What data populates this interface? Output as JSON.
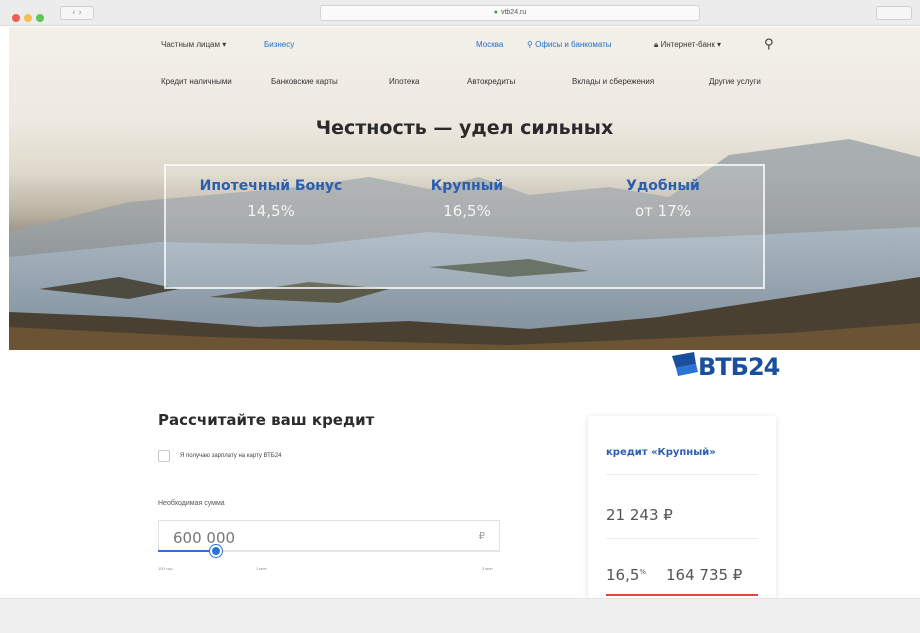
{
  "colors": {
    "brand_blue": "#2a5fb0",
    "accent_blue": "#2b74d6",
    "accent_red": "#e0473a"
  },
  "browser": {
    "url": "vtb24.ru"
  },
  "topnav": {
    "segment_individuals": "Частным лицам ▾",
    "segment_business": "Бизнесу",
    "city": "Москва",
    "offices": "Офисы и банкоматы",
    "internet_bank": "Интернет-банк ▾",
    "search_icon": "search-icon"
  },
  "mainnav": {
    "items": [
      "Кредит наличными",
      "Банковские карты",
      "Ипотека",
      "Автокредиты",
      "Вклады и сбережения",
      "Другие услуги"
    ]
  },
  "hero": {
    "title": "Честность — удел сильных",
    "offers": [
      {
        "name": "Ипотечный Бонус",
        "rate": "14,5%"
      },
      {
        "name": "Крупный",
        "rate": "16,5%"
      },
      {
        "name": "Удобный",
        "rate": "от 17%"
      }
    ]
  },
  "logo": {
    "brand": "ВТБ24"
  },
  "calculator": {
    "title": "Рассчитайте ваш кредит",
    "checkbox_label": "Я получаю зарплату на карту ВТБ24",
    "amount_label": "Необходимая сумма",
    "amount_value": "600 000",
    "currency": "₽",
    "slider_fraction": 0.17,
    "ticks": [
      "100 тыс.",
      "1 млн",
      "3 млн"
    ]
  },
  "result": {
    "product": "кредит «Крупный»",
    "monthly_payment": "21 243 ₽",
    "rate": "16,5",
    "rate_unit": "%",
    "overpayment": "164 735 ₽"
  }
}
